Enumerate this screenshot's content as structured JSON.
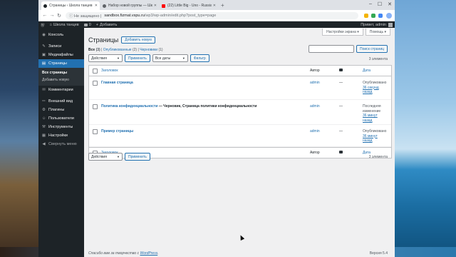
{
  "browser": {
    "tabs": [
      {
        "title": "Страницы ‹ Школа танцев — W",
        "active": true,
        "fav_color": "#1d2327"
      },
      {
        "title": "Набор новой группы — Школ",
        "active": false,
        "fav_color": "#5f6368"
      },
      {
        "title": "(22) Little Big - Uno - Russia e",
        "active": false,
        "fav_color": "#ff0000"
      }
    ],
    "new_tab": "+",
    "window_controls": [
      "–",
      "☐",
      "✕"
    ],
    "security": "Не защищено",
    "url_host": "sandbox.fizmat.vspu.ru",
    "url_path": "/wp3/wp-admin/edit.php?post_type=page",
    "nav": {
      "back": "←",
      "forward": "→",
      "reload": "↻"
    }
  },
  "adminbar": {
    "logo": "Ⓦ",
    "home_icon": "⌂",
    "site_name": "Школа танцев",
    "comments_count": "0",
    "add_new": "Добавить",
    "greeting": "Привет, admin"
  },
  "sidebar": {
    "items": [
      {
        "icon": "◉",
        "label": "Консоль"
      },
      {
        "icon": "✎",
        "label": "Записи"
      },
      {
        "icon": "▣",
        "label": "Медиафайлы"
      },
      {
        "icon": "▤",
        "label": "Страницы",
        "current": true
      },
      {
        "icon": "✉",
        "label": "Комментарии"
      },
      {
        "icon": "✏",
        "label": "Внешний вид"
      },
      {
        "icon": "⚙",
        "label": "Плагины"
      },
      {
        "icon": "☺",
        "label": "Пользователи"
      },
      {
        "icon": "⚒",
        "label": "Инструменты"
      },
      {
        "icon": "▦",
        "label": "Настройки"
      }
    ],
    "submenu": [
      "Все страницы",
      "Добавить новую"
    ],
    "collapse_icon": "◀",
    "collapse": "Свернуть меню"
  },
  "main": {
    "screen_options": "Настройки экрана ▾",
    "help": "Помощь ▾",
    "title": "Страницы",
    "add_new": "Добавить новую",
    "filters": {
      "all": "Все",
      "all_count": "(3)",
      "published": "Опубликованные",
      "published_count": "(2)",
      "drafts": "Черновики",
      "drafts_count": "(1)"
    },
    "search_button": "Поиск страниц",
    "bulk_actions": "Действия",
    "apply": "Применить",
    "all_dates": "Все даты",
    "filter": "Фильтр",
    "items_count": "3 элемента",
    "columns": {
      "title": "Заголовок",
      "author": "Автор",
      "date": "Дата"
    },
    "rows": [
      {
        "title": "Главная страница",
        "suffix": "",
        "author": "admin",
        "comments": "—",
        "status": "Опубликовано",
        "date1": "36 секунд",
        "date2": "назад"
      },
      {
        "title": "Политика конфиденциальности",
        "suffix": " — Черновик, Страница политики конфиденциальности",
        "author": "admin",
        "comments": "—",
        "status": "Последняя изменение",
        "date1": "36 минут",
        "date2": "назад"
      },
      {
        "title": "Пример страницы",
        "suffix": "",
        "author": "admin",
        "comments": "—",
        "status": "Опубликовано",
        "date1": "36 минут",
        "date2": "назад"
      }
    ],
    "footer_text": "Спасибо вам за творчество с ",
    "footer_link": "WordPress",
    "version": "Версия 5.4"
  }
}
